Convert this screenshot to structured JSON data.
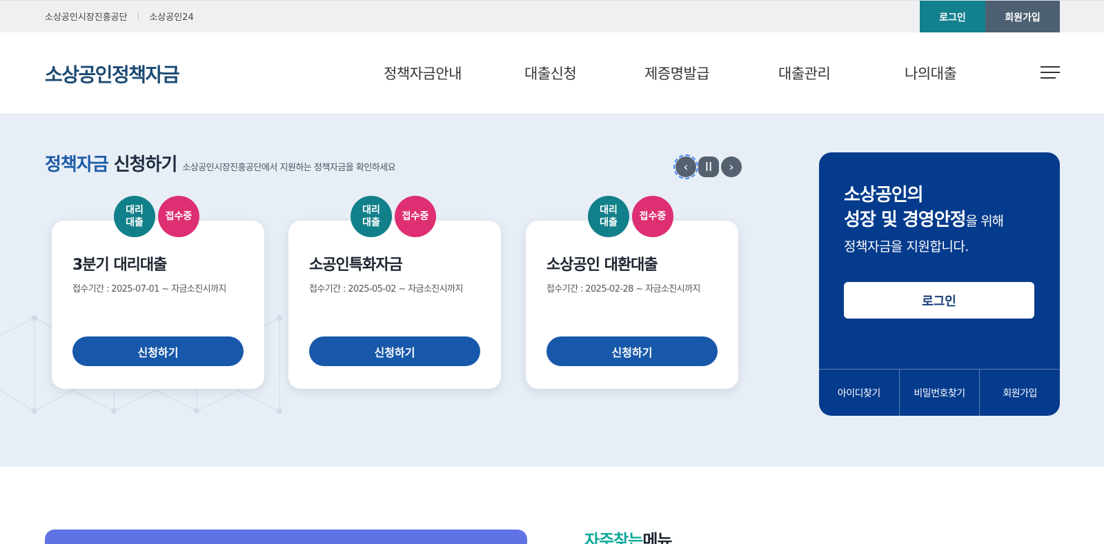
{
  "utility": {
    "links": [
      "소상공인시장진흥공단",
      "소상공인24"
    ],
    "separator": "|",
    "login_label": "로그인",
    "join_label": "회원가입"
  },
  "header": {
    "logo": "소상공인정책자금",
    "nav": [
      "정책자금안내",
      "대출신청",
      "제증명발급",
      "대출관리",
      "나의대출"
    ]
  },
  "hero": {
    "title_highlight": "정책자금",
    "title_rest": "신청하기",
    "subtitle": "소상공인시장진흥공단에서 지원하는 정책자금을 확인하세요",
    "controls": {
      "prev": "‹",
      "pause": "II",
      "next": "›"
    },
    "cards": [
      {
        "badge_type": "대리\n대출",
        "badge_status": "접수중",
        "title": "3분기 대리대출",
        "period": "접수기간 : 2025-07-01 ~ 자금소진시까지",
        "button": "신청하기"
      },
      {
        "badge_type": "대리\n대출",
        "badge_status": "접수중",
        "title": "소공인특화자금",
        "period": "접수기간 : 2025-05-02 ~ 자금소진시까지",
        "button": "신청하기"
      },
      {
        "badge_type": "대리\n대출",
        "badge_status": "접수중",
        "title": "소상공인 대환대출",
        "period": "접수기간 : 2025-02-28 ~ 자금소진시까지",
        "button": "신청하기"
      }
    ]
  },
  "login_box": {
    "line1": "소상공인의",
    "line2_bold": "성장 및 경영안정",
    "line2_rest": "을 위해",
    "line3": "정책자금을 지원합니다.",
    "button": "로그인",
    "links": [
      "아이디찾기",
      "비밀번호찾기",
      "회원가입"
    ]
  },
  "bottom": {
    "freq_highlight": "자주찾는",
    "freq_rest": "메뉴"
  },
  "colors": {
    "brand_navy": "#053b8c",
    "button_blue": "#1858aa",
    "teal": "#12808a",
    "pink": "#de2f72",
    "hero_bg": "#e7eef6"
  }
}
